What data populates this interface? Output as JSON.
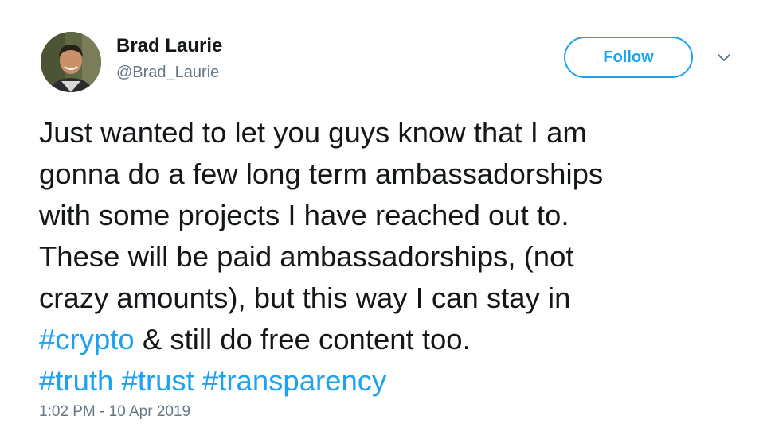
{
  "author": {
    "name": "Brad Laurie",
    "handle": "@Brad_Laurie"
  },
  "follow": {
    "label": "Follow"
  },
  "menu": {
    "icon": "chevron-down-icon"
  },
  "tweet": {
    "line1": "Just wanted to let you guys know that I am",
    "line2": "gonna do a few long term ambassadorships",
    "line3": "with some projects I have reached out to.",
    "line4": "These will be paid ambassadorships, (not",
    "line5": "crazy amounts), but this way I can stay in",
    "hashtag_crypto": "#crypto",
    "line6_rest": " & still do free content too.",
    "hashtag_truth": "#truth",
    "hashtag_trust": "#trust",
    "hashtag_transparency": "#transparency"
  },
  "timestamp": "1:02 PM - 10 Apr 2019",
  "colors": {
    "accent": "#1da1f2",
    "text": "#14171a",
    "muted": "#657786"
  }
}
